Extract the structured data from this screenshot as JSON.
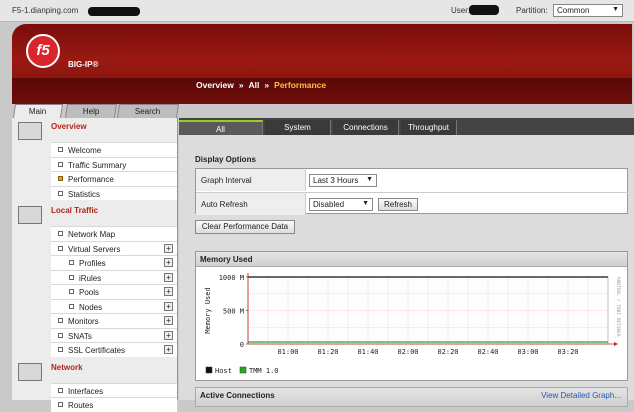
{
  "topbar": {
    "host": "F5-1.dianping.com",
    "user_label": "User:",
    "partition_label": "Partition:",
    "partition_value": "Common"
  },
  "banner": {
    "logo_text": "f5",
    "product": "BIG-IP®",
    "breadcrumb": [
      "Overview",
      "All",
      "Performance"
    ],
    "separator": "»"
  },
  "left_tabs": [
    "Main",
    "Help",
    "Search"
  ],
  "sidebar": {
    "sections": [
      {
        "title": "Overview",
        "items": [
          {
            "label": "Welcome",
            "selected": false
          },
          {
            "label": "Traffic Summary",
            "selected": false
          },
          {
            "label": "Performance",
            "selected": true
          },
          {
            "label": "Statistics",
            "selected": false
          }
        ]
      },
      {
        "title": "Local Traffic",
        "items": [
          {
            "label": "Network Map"
          },
          {
            "label": "Virtual Servers",
            "plus": true
          },
          {
            "label": "Profiles",
            "plus": true,
            "sub": true
          },
          {
            "label": "iRules",
            "plus": true,
            "sub": true
          },
          {
            "label": "Pools",
            "plus": true,
            "sub": true
          },
          {
            "label": "Nodes",
            "plus": true,
            "sub": true
          },
          {
            "label": "Monitors",
            "plus": true
          },
          {
            "label": "SNATs",
            "plus": true
          },
          {
            "label": "SSL Certificates",
            "plus": true
          }
        ]
      },
      {
        "title": "Network",
        "items": [
          {
            "label": "Interfaces"
          },
          {
            "label": "Routes"
          }
        ]
      }
    ]
  },
  "main_tabs": [
    "All",
    "System",
    "Connections",
    "Throughput"
  ],
  "display_options": {
    "title": "Display Options",
    "graph_interval_label": "Graph Interval",
    "graph_interval_value": "Last 3 Hours",
    "auto_refresh_label": "Auto Refresh",
    "auto_refresh_value": "Disabled",
    "refresh_button": "Refresh",
    "clear_button": "Clear Performance Data"
  },
  "memory_panel": {
    "title": "Memory Used"
  },
  "active_connections": {
    "title": "Active Connections",
    "link": "View Detailed Graph..."
  },
  "chart_data": {
    "type": "line",
    "title": "",
    "ylabel": "Memory Used",
    "ytick_labels": [
      "1000 M",
      "500 M",
      "0"
    ],
    "ylim": [
      0,
      1000
    ],
    "x": [
      "00:40",
      "00:50",
      "01:00",
      "01:10",
      "01:20",
      "01:30",
      "01:40",
      "01:50",
      "02:00",
      "02:10",
      "02:20",
      "02:30",
      "02:40",
      "02:50",
      "03:00",
      "03:10",
      "03:20",
      "03:30",
      "03:40"
    ],
    "xtick_labels": [
      "01:00",
      "01:20",
      "01:40",
      "02:00",
      "02:20",
      "02:40",
      "03:00",
      "03:20"
    ],
    "series": [
      {
        "name": "Host",
        "color": "#111111",
        "values": [
          1000,
          1000,
          1000,
          1000,
          1000,
          1000,
          1000,
          1000,
          1000,
          1000,
          1000,
          1000,
          1000,
          1000,
          1000,
          1000,
          1000,
          1000,
          1000
        ]
      },
      {
        "name": "TMM 1.0",
        "color": "#22aa22",
        "values": [
          30,
          30,
          30,
          30,
          30,
          30,
          30,
          30,
          30,
          30,
          30,
          30,
          30,
          30,
          30,
          30,
          30,
          30,
          30
        ]
      }
    ],
    "side_text": "RRDTOOL / TOBI OETIKER",
    "grid": true
  }
}
